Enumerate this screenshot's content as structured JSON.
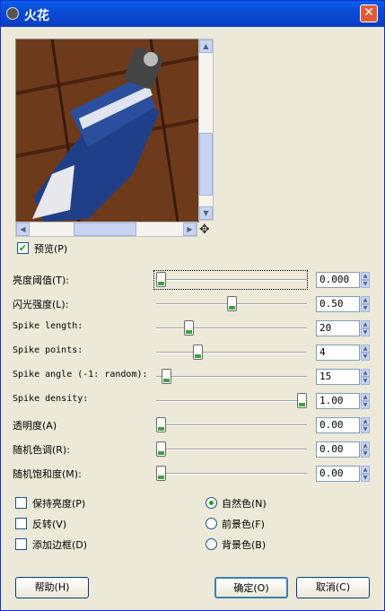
{
  "window": {
    "title": "火花",
    "close_label": "✕"
  },
  "preview": {
    "checkbox_label": "预览(P)",
    "checked": true
  },
  "sliders": [
    {
      "label": "亮度阈值(T):",
      "value": "0.000",
      "fraction": 0.0,
      "mono": false
    },
    {
      "label": "闪光强度(L):",
      "value": "0.50",
      "fraction": 0.5,
      "mono": false
    },
    {
      "label": "Spike length:",
      "value": "20",
      "fraction": 0.2,
      "mono": true
    },
    {
      "label": "Spike points:",
      "value": "4",
      "fraction": 0.26,
      "mono": true
    },
    {
      "label": "Spike angle (-1: random):",
      "value": "15",
      "fraction": 0.04,
      "mono": true
    },
    {
      "label": "Spike density:",
      "value": "1.00",
      "fraction": 1.0,
      "mono": true
    },
    {
      "label": "透明度(A)",
      "value": "0.00",
      "fraction": 0.0,
      "mono": false
    },
    {
      "label": "随机色调(R):",
      "value": "0.00",
      "fraction": 0.0,
      "mono": false
    },
    {
      "label": "随机饱和度(M):",
      "value": "0.00",
      "fraction": 0.0,
      "mono": false
    }
  ],
  "checkboxes": [
    {
      "label": "保持亮度(P)",
      "checked": false
    },
    {
      "label": "反转(V)",
      "checked": false
    },
    {
      "label": "添加边框(D)",
      "checked": false
    }
  ],
  "radios": [
    {
      "label": "自然色(N)",
      "selected": true
    },
    {
      "label": "前景色(F)",
      "selected": false
    },
    {
      "label": "背景色(B)",
      "selected": false
    }
  ],
  "buttons": {
    "help": "帮助(H)",
    "ok": "确定(O)",
    "cancel": "取消(C)"
  },
  "icons": {
    "close": "close-icon",
    "move": "move-icon",
    "check": "checkmark-icon"
  }
}
